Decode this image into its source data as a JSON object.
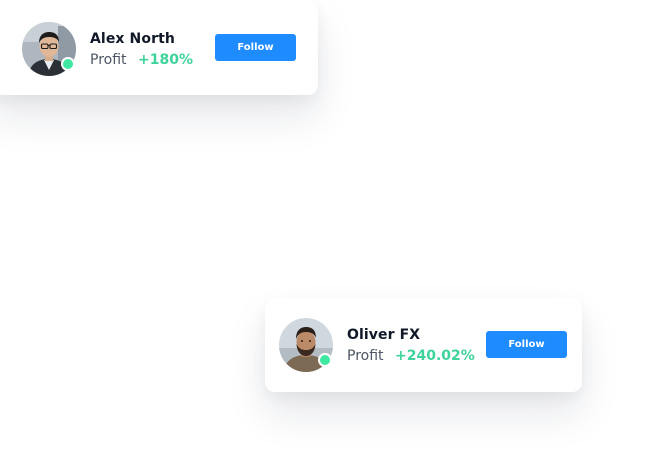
{
  "theme": {
    "accent": "#1e8bff",
    "profit_color": "#3dd39a",
    "online_color": "#3ee8a0"
  },
  "traders": [
    {
      "name": "Alex North",
      "profit_label": "Profit",
      "profit_value": "+180%",
      "follow_label": "Follow",
      "online": true,
      "avatar": "avatar-photo-man-glasses"
    },
    {
      "name": "Oliver FX",
      "profit_label": "Profit",
      "profit_value": "+240.02%",
      "follow_label": "Follow",
      "online": true,
      "avatar": "avatar-photo-man-beard"
    }
  ]
}
